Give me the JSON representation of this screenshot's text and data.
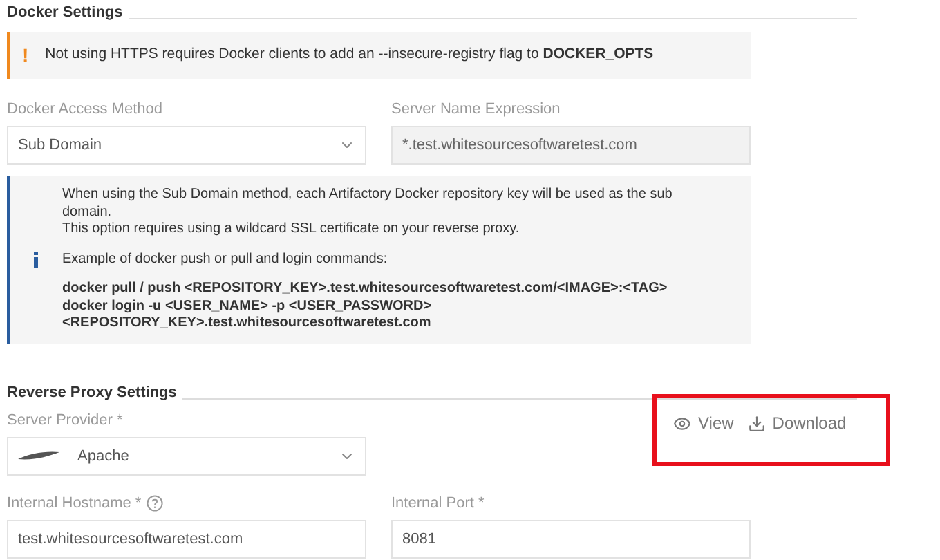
{
  "docker_settings": {
    "title": "Docker Settings",
    "warning": {
      "text": "Not using HTTPS requires Docker clients to add an --insecure-registry flag to **DOCKER_OPTS**",
      "icon": "!"
    },
    "fields": [
      {
        "label": "Docker Access Method",
        "value": "Sub Domain",
        "kind": "select",
        "disabled": false
      },
      {
        "label": "Server Name Expression",
        "value": "*.test.whitesourcesoftwaretest.com",
        "kind": "text",
        "disabled": true
      }
    ],
    "info": {
      "paragraphs": [
        {
          "kind": "text",
          "lines": [
            "When using the Sub Domain method, each Artifactory Docker repository key will be used as the sub domain.",
            "This option requires using a wildcard SSL certificate on your reverse proxy."
          ]
        },
        {
          "kind": "text",
          "lines": [
            "Example of docker push or pull and login commands:"
          ]
        },
        {
          "kind": "code",
          "lines": [
            "docker pull / push <REPOSITORY_KEY>.test.whitesourcesoftwaretest.com/<IMAGE>:<TAG>",
            "docker login -u <USER_NAME> -p <USER_PASSWORD>",
            "<REPOSITORY_KEY>.test.whitesourcesoftwaretest.com"
          ]
        }
      ]
    }
  },
  "reverse_proxy": {
    "title": "Reverse Proxy Settings",
    "server_provider": {
      "label": "Server Provider *",
      "value": "Apache"
    },
    "actions": [
      {
        "kind": "view",
        "label": "View"
      },
      {
        "kind": "download",
        "label": "Download"
      }
    ],
    "fields": [
      {
        "label": "Internal Hostname *",
        "help": true,
        "value": "test.whitesourcesoftwaretest.com"
      },
      {
        "label": "Internal Port *",
        "help": false,
        "value": "8081"
      }
    ]
  }
}
